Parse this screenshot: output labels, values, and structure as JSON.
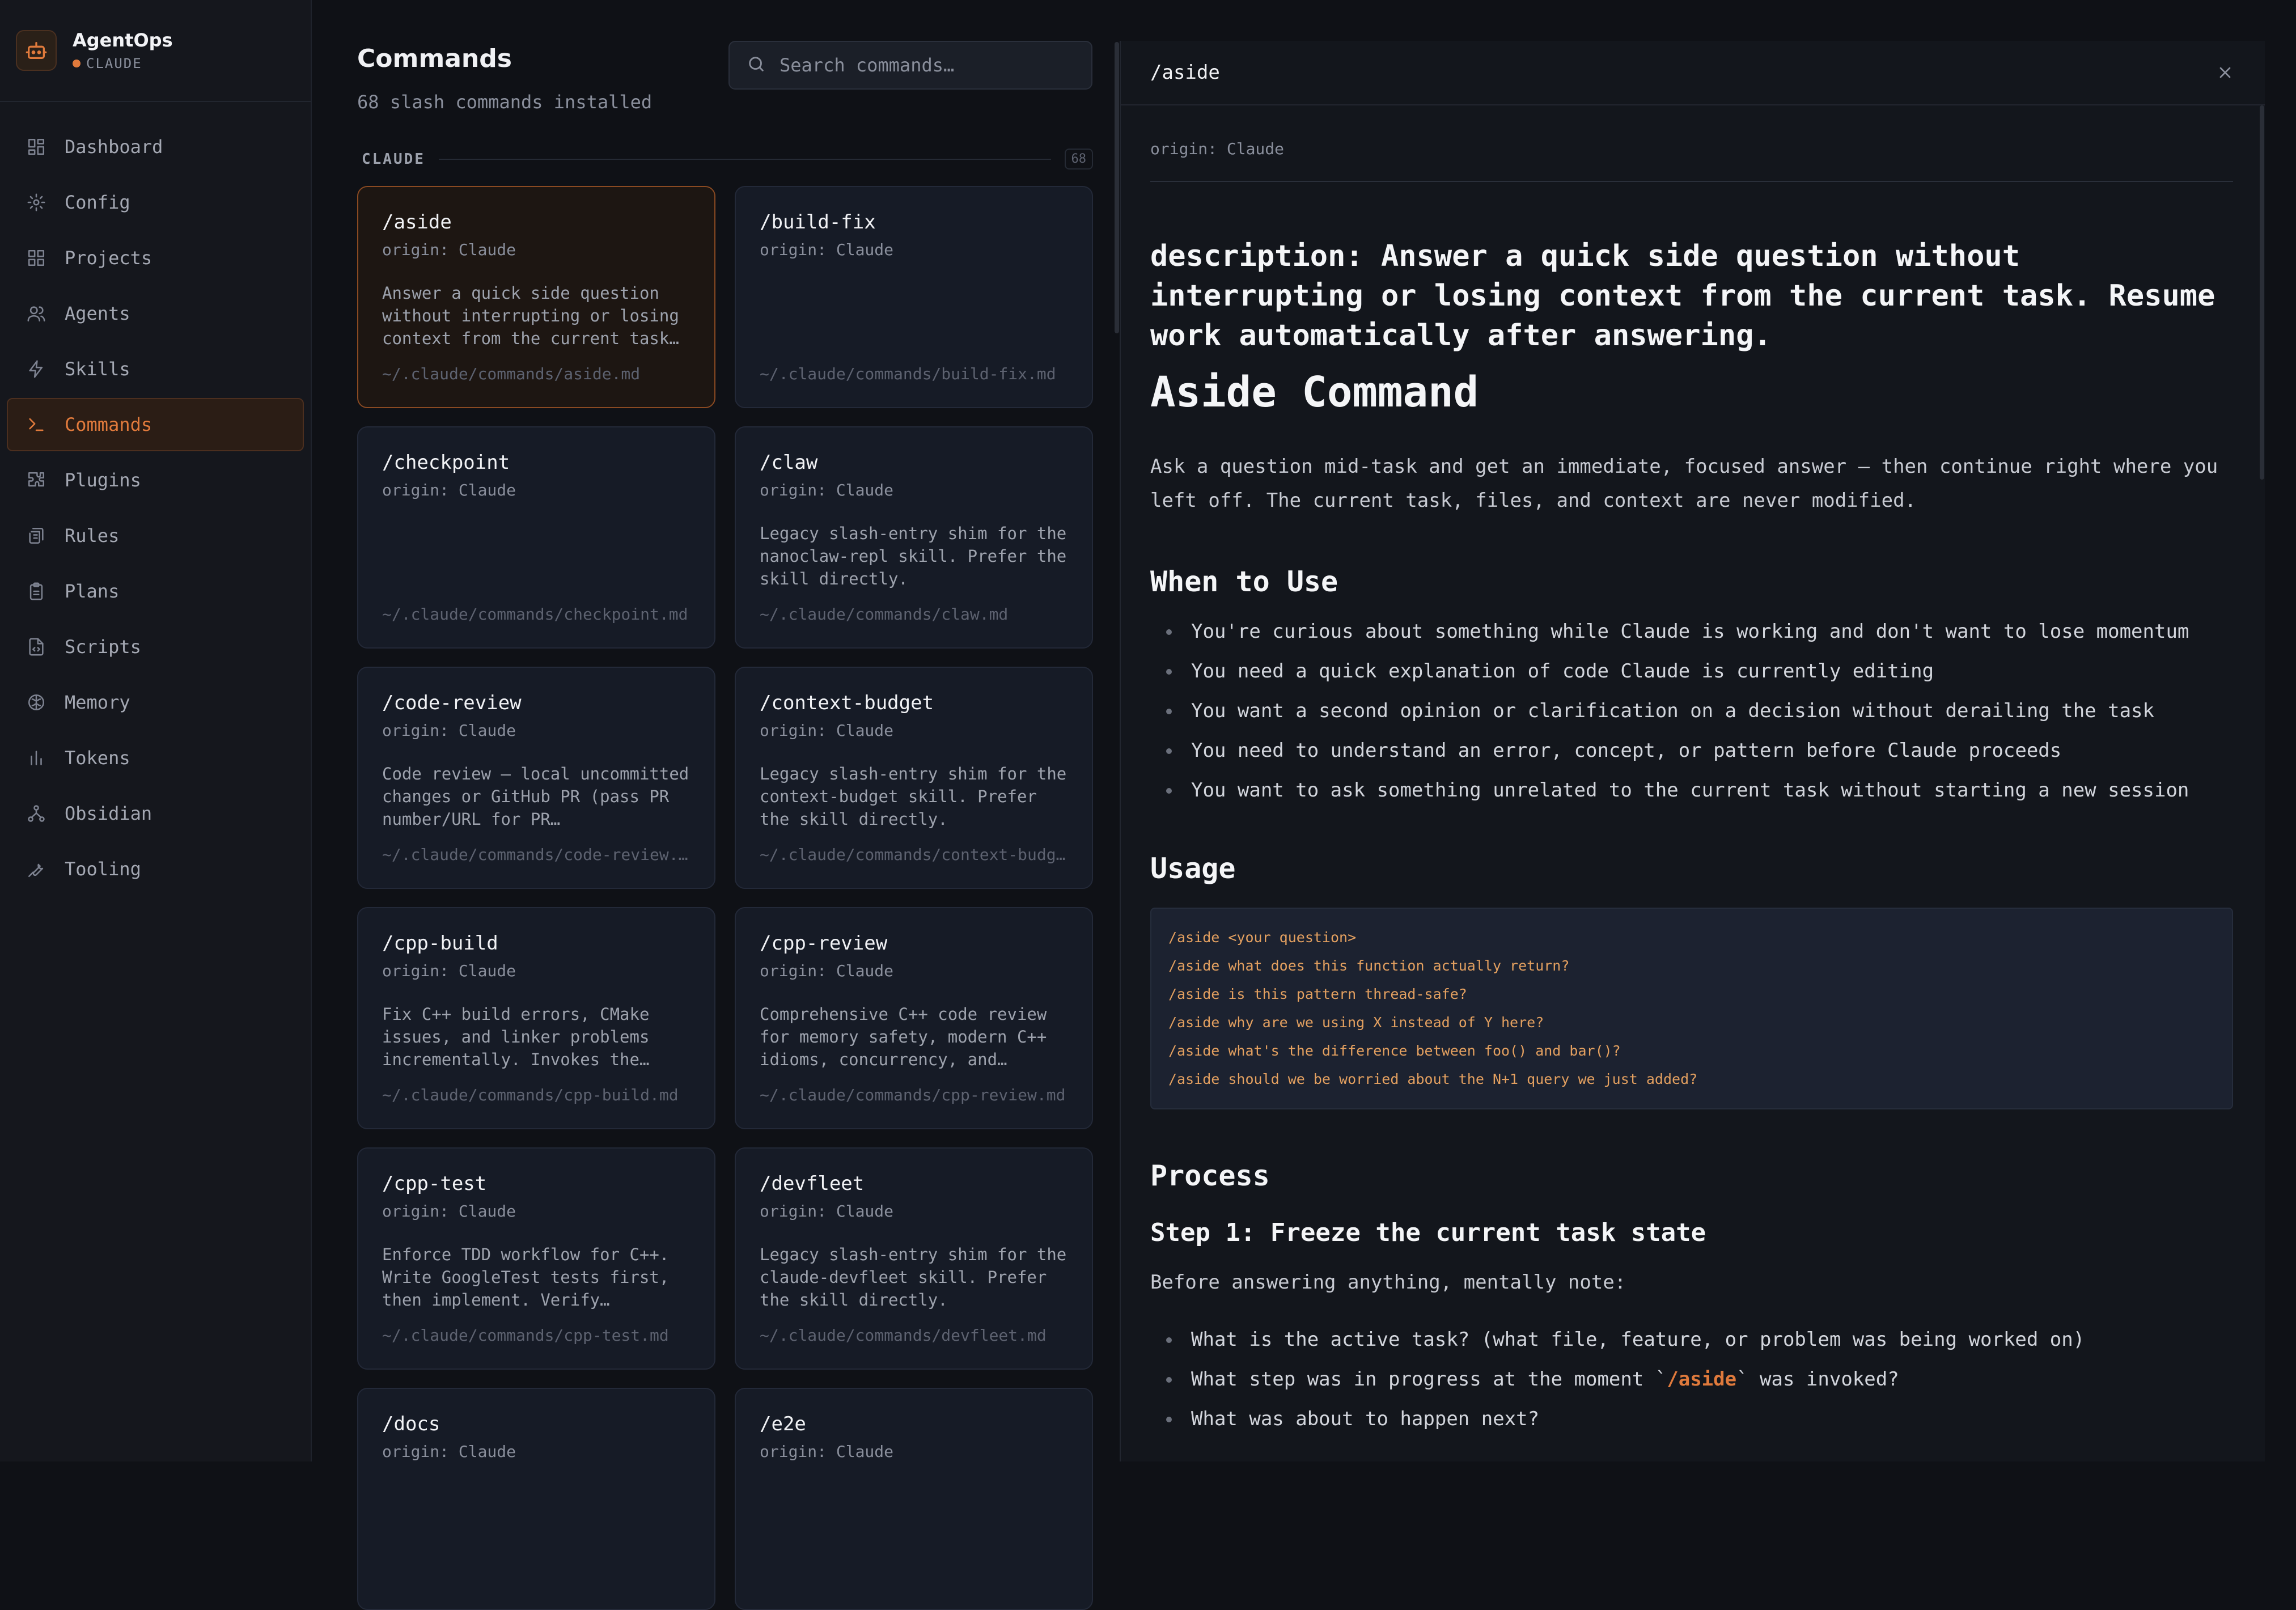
{
  "app": {
    "name": "AgentOps",
    "subtitle": "CLAUDE"
  },
  "sidebar": {
    "items": [
      {
        "label": "Dashboard",
        "icon": "dashboard-icon"
      },
      {
        "label": "Config",
        "icon": "gear-icon"
      },
      {
        "label": "Projects",
        "icon": "grid-icon"
      },
      {
        "label": "Agents",
        "icon": "users-icon"
      },
      {
        "label": "Skills",
        "icon": "bolt-icon"
      },
      {
        "label": "Commands",
        "icon": "terminal-icon",
        "active": true
      },
      {
        "label": "Plugins",
        "icon": "puzzle-icon"
      },
      {
        "label": "Rules",
        "icon": "scroll-icon"
      },
      {
        "label": "Plans",
        "icon": "clipboard-icon"
      },
      {
        "label": "Scripts",
        "icon": "file-code-icon"
      },
      {
        "label": "Memory",
        "icon": "brain-icon"
      },
      {
        "label": "Tokens",
        "icon": "bar-chart-icon"
      },
      {
        "label": "Obsidian",
        "icon": "network-icon"
      },
      {
        "label": "Tooling",
        "icon": "wrench-icon"
      }
    ]
  },
  "commands": {
    "title": "Commands",
    "subtitle": "68 slash commands installed",
    "search_placeholder": "Search commands…",
    "group_label": "CLAUDE",
    "group_count": "68",
    "cards": [
      {
        "title": "/aside",
        "origin": "origin: Claude",
        "desc": "Answer a quick side question without interrupting or losing context from the current task…",
        "path": "~/.claude/commands/aside.md"
      },
      {
        "title": "/build-fix",
        "origin": "origin: Claude",
        "desc": "",
        "path": "~/.claude/commands/build-fix.md"
      },
      {
        "title": "/checkpoint",
        "origin": "origin: Claude",
        "desc": "",
        "path": "~/.claude/commands/checkpoint.md"
      },
      {
        "title": "/claw",
        "origin": "origin: Claude",
        "desc": "Legacy slash-entry shim for the nanoclaw-repl skill. Prefer the skill directly.",
        "path": "~/.claude/commands/claw.md"
      },
      {
        "title": "/code-review",
        "origin": "origin: Claude",
        "desc": "Code review — local uncommitted changes or GitHub PR (pass PR number/URL for PR…",
        "path": "~/.claude/commands/code-review.md"
      },
      {
        "title": "/context-budget",
        "origin": "origin: Claude",
        "desc": "Legacy slash-entry shim for the context-budget skill. Prefer the skill directly.",
        "path": "~/.claude/commands/context-budget.md"
      },
      {
        "title": "/cpp-build",
        "origin": "origin: Claude",
        "desc": "Fix C++ build errors, CMake issues, and linker problems incrementally. Invokes the…",
        "path": "~/.claude/commands/cpp-build.md"
      },
      {
        "title": "/cpp-review",
        "origin": "origin: Claude",
        "desc": "Comprehensive C++ code review for memory safety, modern C++ idioms, concurrency, and…",
        "path": "~/.claude/commands/cpp-review.md"
      },
      {
        "title": "/cpp-test",
        "origin": "origin: Claude",
        "desc": "Enforce TDD workflow for C++. Write GoogleTest tests first, then implement. Verify…",
        "path": "~/.claude/commands/cpp-test.md"
      },
      {
        "title": "/devfleet",
        "origin": "origin: Claude",
        "desc": "Legacy slash-entry shim for the claude-devfleet skill. Prefer the skill directly.",
        "path": "~/.claude/commands/devfleet.md"
      },
      {
        "title": "/docs",
        "origin": "origin: Claude",
        "desc": "",
        "path": ""
      },
      {
        "title": "/e2e",
        "origin": "origin: Claude",
        "desc": "",
        "path": ""
      }
    ]
  },
  "detail": {
    "title": "/aside",
    "origin": "origin: Claude",
    "description": "description: Answer a quick side question without interrupting or losing context from the current task. Resume work automatically after answering.",
    "heading": "Aside Command",
    "intro": "Ask a question mid-task and get an immediate, focused answer — then continue right where you left off. The current task, files, and context are never modified.",
    "when_heading": "When to Use",
    "when_items": [
      "You're curious about something while Claude is working and don't want to lose momentum",
      "You need a quick explanation of code Claude is currently editing",
      "You want a second opinion or clarification on a decision without derailing the task",
      "You need to understand an error, concept, or pattern before Claude proceeds",
      "You want to ask something unrelated to the current task without starting a new session"
    ],
    "usage_heading": "Usage",
    "usage_lines": [
      "/aside <your question>",
      "/aside what does this function actually return?",
      "/aside is this pattern thread-safe?",
      "/aside why are we using X instead of Y here?",
      "/aside what's the difference between foo() and bar()?",
      "/aside should we be worried about the N+1 query we just added?"
    ],
    "process_heading": "Process",
    "step1_heading": "Step 1: Freeze the current task state",
    "step1_intro": "Before answering anything, mentally note:",
    "step1_items": [
      {
        "before": "What is the active task? (what file, feature, or problem was being worked on)",
        "code": "",
        "after": ""
      },
      {
        "before": "What step was in progress at the moment `",
        "code": "/aside",
        "after": "` was invoked?"
      },
      {
        "before": "What was about to happen next?",
        "code": "",
        "after": ""
      }
    ]
  },
  "colors": {
    "accent": "#e07a3c",
    "background": "#0f1116",
    "card": "#161b26"
  }
}
